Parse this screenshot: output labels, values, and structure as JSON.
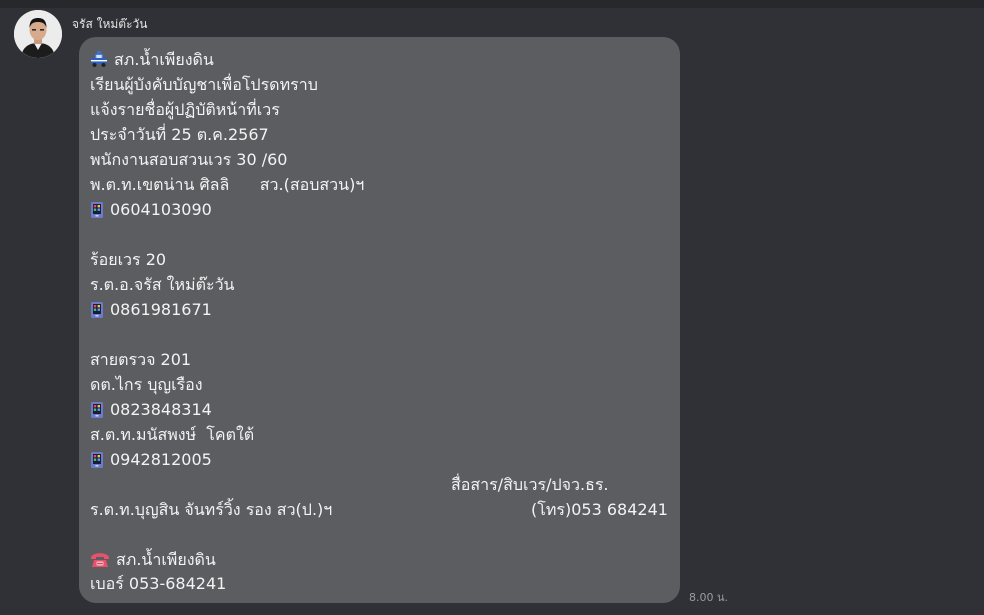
{
  "chat": {
    "sender_name": "จรัส ใหม่ต๊ะวัน",
    "timestamp": "8.00 น."
  },
  "message": {
    "header_icon": "police-car-icon",
    "header": "สภ.น้ำเพียงดิน",
    "lines": [
      "เรียนผู้บังคับบัญชาเพื่อโปรดทราบ",
      "แจ้งรายชื่อผู้ปฏิบัติหน้าที่เวร",
      "ประจำวันที่ 25 ต.ค.2567",
      "พนักงานสอบสวนเวร 30 /60",
      "พ.ต.ท.เขตน่าน ศิลลิ      สว.(สอบสวน)ฯ"
    ],
    "phone_icon": "mobile-phone-icon",
    "phone_1": "0604103090",
    "section_2_title": "ร้อยเวร 20",
    "section_2_name": "ร.ต.อ.จรัส ใหม่ต๊ะวัน",
    "phone_2": "0861981671",
    "section_3_title": "สายตรวจ 201",
    "section_3_name_1": "ดต.ไกร บุญเรือง",
    "phone_3": "0823848314",
    "section_3_name_2": "ส.ต.ท.มนัสพงษ์  โคตใต้",
    "phone_4": "0942812005",
    "comm_label": "สื่อสาร/สิบเวร/ปจว.ธร.",
    "comm_name": "ร.ต.ท.บุญสิน จันทร์วิ้ง รอง สว(ป.)ฯ",
    "comm_phone": "(โทร)053 684241",
    "footer_icon": "telephone-icon",
    "footer_station": "สภ.น้ำเพียงดิน",
    "footer_number": "เบอร์ 053-684241"
  },
  "colors": {
    "background": "#2f3136",
    "bubble": "#5b5d61",
    "text": "#f3f3f3",
    "timestamp": "#9a9ca0"
  }
}
